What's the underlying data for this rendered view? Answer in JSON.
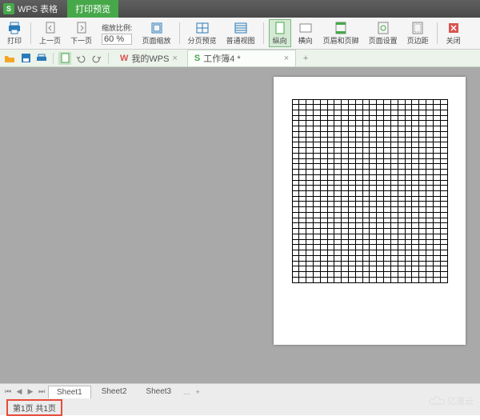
{
  "title": {
    "app": "S",
    "name": "WPS 表格",
    "active_tab": "打印预览"
  },
  "ribbon": {
    "print": "打印",
    "prev_page": "上一页",
    "next_page": "下一页",
    "zoom_label": "缩放比例:",
    "zoom_value": "60 %",
    "page_zoom": "页面缩放",
    "page_break": "分页预览",
    "normal_view": "普通视图",
    "portrait": "纵向",
    "landscape": "横向",
    "header_footer": "页眉和页脚",
    "page_setup": "页面设置",
    "margins": "页边距",
    "close": "关闭"
  },
  "toolbar": {
    "docs": [
      {
        "icon": "W",
        "label": "我的WPS",
        "close": "×"
      },
      {
        "icon": "S",
        "label": "工作簿4 *",
        "close": "×"
      }
    ],
    "add": "+"
  },
  "sheets": {
    "items": [
      "Sheet1",
      "Sheet2",
      "Sheet3"
    ],
    "more": "…",
    "add": "+"
  },
  "status": {
    "page_info": "第1页 共1页"
  },
  "watermark": "亿速云"
}
